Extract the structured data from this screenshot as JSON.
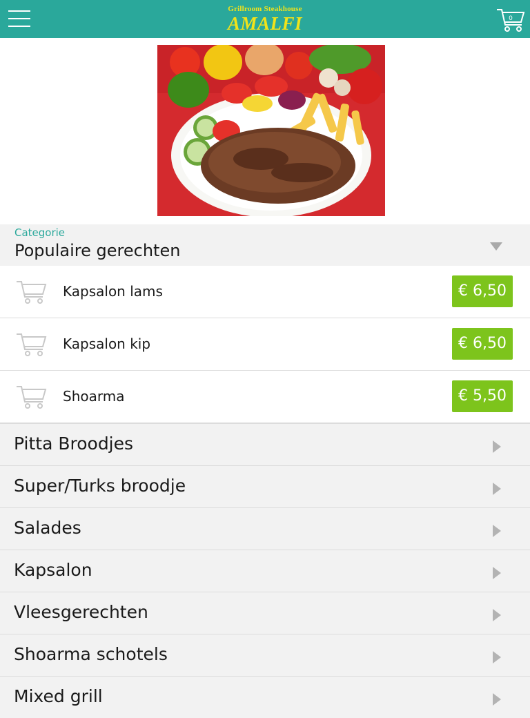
{
  "header": {
    "brand_sub": "Grillroom Steakhouse",
    "brand_main": "AMALFI",
    "cart_count": "0"
  },
  "category": {
    "label": "Categorie",
    "selected": "Populaire gerechten"
  },
  "products": [
    {
      "name": "Kapsalon lams",
      "price": "€ 6,50"
    },
    {
      "name": "Kapsalon kip",
      "price": "€ 6,50"
    },
    {
      "name": "Shoarma",
      "price": "€ 5,50"
    }
  ],
  "categories": [
    {
      "name": "Pitta Broodjes"
    },
    {
      "name": "Super/Turks broodje"
    },
    {
      "name": "Salades"
    },
    {
      "name": "Kapsalon"
    },
    {
      "name": "Vleesgerechten"
    },
    {
      "name": "Shoarma schotels"
    },
    {
      "name": "Mixed grill"
    }
  ],
  "colors": {
    "header_bg": "#2aa89b",
    "brand_yellow": "#f1e31a",
    "price_green": "#7dc41c",
    "list_bg": "#f2f2f2"
  },
  "icons": [
    "menu-icon",
    "cart-icon",
    "chevron-down-icon",
    "chevron-right-icon"
  ]
}
